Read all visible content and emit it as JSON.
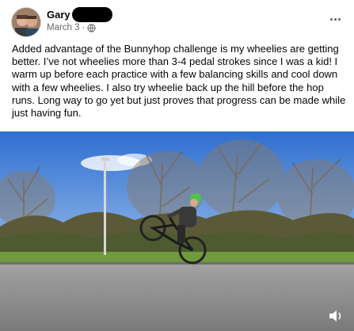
{
  "post": {
    "author_name": "Gary",
    "date": "March 3",
    "separator": "·",
    "privacy_icon": "globe-icon",
    "more_icon": "more-options-icon",
    "body": "Added advantage of the Bunnyhop challenge is my wheelies are getting better. I’ve not wheelies more than 3-4 pedal strokes since I was a kid! I warm up before each practice with a few balancing skills and cool down with a few wheelies. I also try wheelie back up the hill before the hop runs. Long way to go yet but just proves that progress can be made while just having fun."
  },
  "media": {
    "type": "video",
    "volume_icon": "speaker-icon"
  },
  "colors": {
    "text": "#050505",
    "secondary_text": "#65676b",
    "sky": "#5e8fd6",
    "road": "#8e8e8e"
  }
}
